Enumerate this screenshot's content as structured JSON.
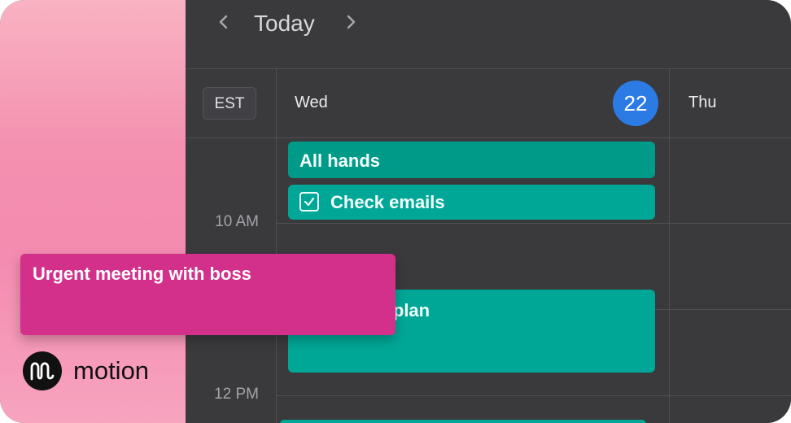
{
  "header": {
    "title": "Today",
    "prev_icon": "chevron-left-icon",
    "next_icon": "chevron-right-icon"
  },
  "calendar": {
    "timezone": "EST",
    "days": [
      {
        "label": "Wed",
        "date": "22"
      },
      {
        "label": "Thu"
      }
    ],
    "times": [
      "10 AM",
      "12 PM"
    ],
    "events": {
      "all_hands": "All hands",
      "check_emails": "Check emails",
      "plan_partial": "nt plan",
      "urgent": "Urgent meeting with boss"
    }
  },
  "brand": {
    "name": "motion"
  },
  "colors": {
    "calendar_bg": "#3a393c",
    "event_teal": "#00a796",
    "event_urgent": "#d2308a",
    "today_badge": "#2c7be5"
  }
}
